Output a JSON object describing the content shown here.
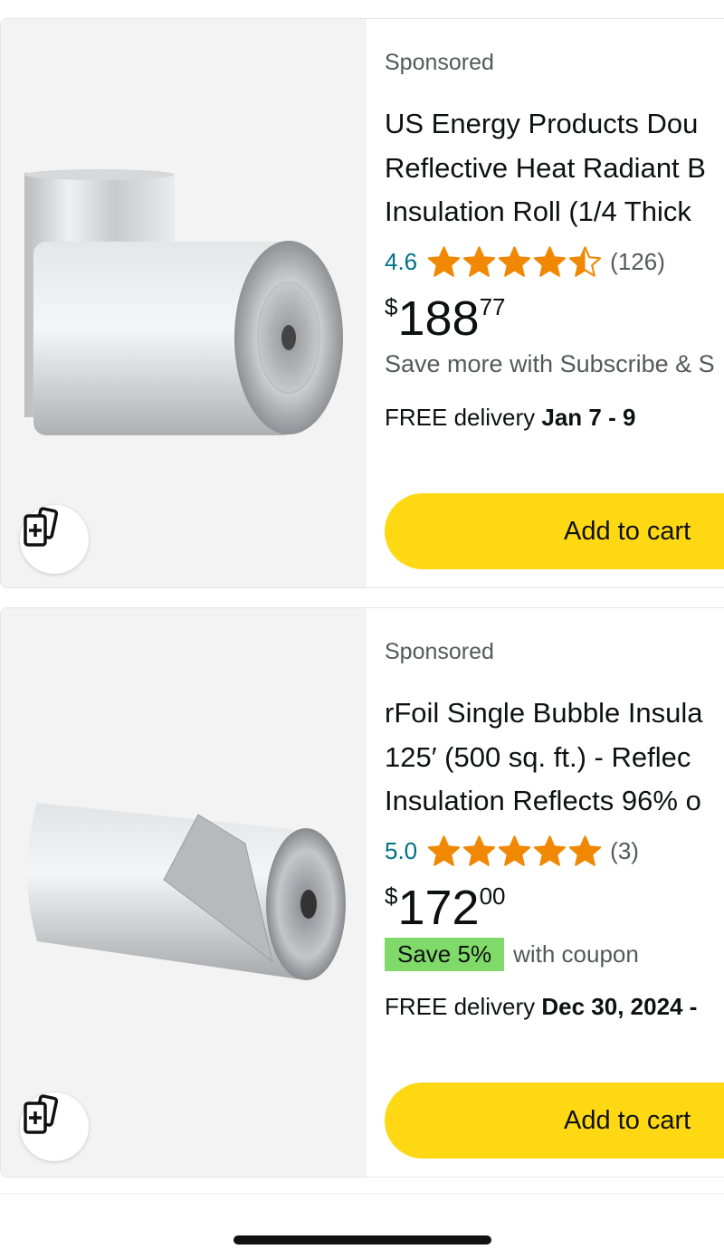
{
  "products": [
    {
      "sponsored": "Sponsored",
      "title_lines": [
        "US Energy Products Dou",
        "Reflective Heat Radiant B",
        "Insulation Roll (1/4 Thick"
      ],
      "rating": "4.6",
      "stars": 4.5,
      "reviews": "(126)",
      "price": {
        "symbol": "$",
        "whole": "188",
        "fraction": "77"
      },
      "promo": "Save more with Subscribe & S",
      "delivery_prefix": "FREE delivery ",
      "delivery_date": "Jan 7 - 9",
      "cart_label": "Add to cart",
      "compare_icon": "compare-cards-icon"
    },
    {
      "sponsored": "Sponsored",
      "title_lines": [
        "rFoil Single Bubble Insula",
        "125′ (500 sq. ft.) - Reflec",
        "Insulation Reflects 96% o"
      ],
      "rating": "5.0",
      "stars": 5,
      "reviews": "(3)",
      "price": {
        "symbol": "$",
        "whole": "172",
        "fraction": "00"
      },
      "coupon_badge": "Save 5%",
      "coupon_text": "with coupon",
      "delivery_prefix": "FREE delivery ",
      "delivery_date": "Dec 30, 2024 -",
      "cart_label": "Add to cart",
      "compare_icon": "compare-cards-icon"
    }
  ],
  "colors": {
    "star": "#f08804",
    "cart_button": "#ffd814",
    "coupon_badge": "#7fda69",
    "rating_link": "#007185"
  }
}
